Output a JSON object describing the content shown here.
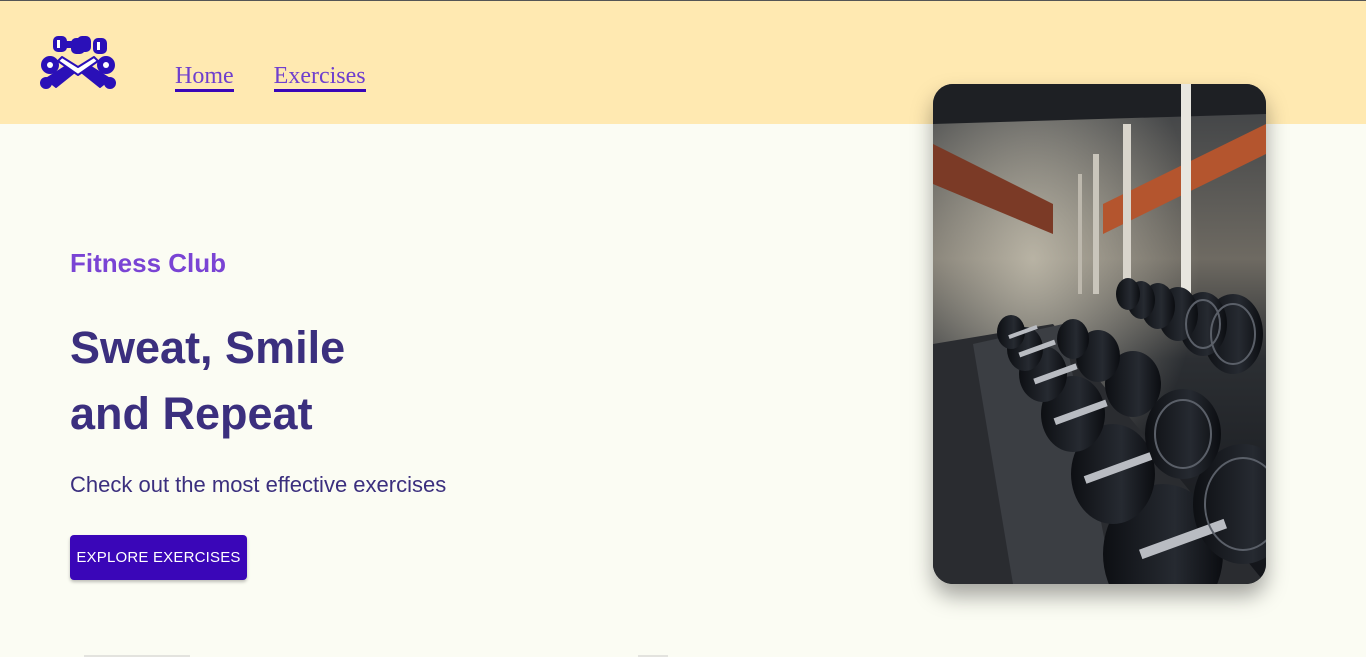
{
  "nav": {
    "home": "Home",
    "exercises": "Exercises"
  },
  "hero": {
    "eyebrow": "Fitness Club",
    "headline_line1": "Sweat, Smile",
    "headline_line2": "and Repeat",
    "subtext": "Check out the most effective exercises",
    "cta": "EXPLORE EXERCISES"
  },
  "colors": {
    "header_bg": "#ffe9b1",
    "page_bg": "#fbfcf3",
    "accent": "#3a06b8",
    "eyebrow": "#7a44d4",
    "headline": "#3b2f7e"
  },
  "icons": {
    "logo": "dumbbell-logo-icon"
  }
}
